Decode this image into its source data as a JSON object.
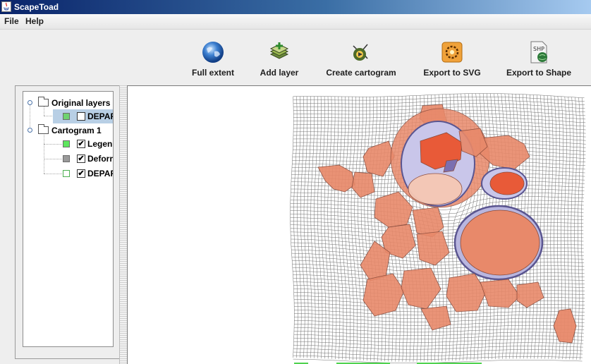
{
  "window": {
    "title": "ScapeToad",
    "icon": "java-icon"
  },
  "menu": {
    "items": [
      "File",
      "Help"
    ]
  },
  "toolbar": {
    "buttons": [
      {
        "label": "Full extent",
        "icon": "globe-icon"
      },
      {
        "label": "Add layer",
        "icon": "add-layer-icon"
      },
      {
        "label": "Create cartogram",
        "icon": "create-cartogram-icon"
      },
      {
        "label": "Export to SVG",
        "icon": "export-svg-icon"
      },
      {
        "label": "Export to Shape",
        "icon": "export-shape-icon"
      }
    ]
  },
  "layers": {
    "groups": [
      {
        "label": "Original layers",
        "items": [
          {
            "label": "DEPAR",
            "checked": false,
            "swatch_color": "#6fd36f",
            "selected": true
          }
        ]
      },
      {
        "label": "Cartogram 1",
        "items": [
          {
            "label": "Legen",
            "checked": true,
            "swatch_color": "#5ee65e",
            "selected": false
          },
          {
            "label": "Deforr",
            "checked": true,
            "swatch_color": "#9a9a9a",
            "selected": false
          },
          {
            "label": "DEPAR",
            "checked": true,
            "swatch_color": "#ffffff",
            "selected": false
          }
        ]
      }
    ]
  },
  "colors": {
    "titlebar_start": "#0a246a",
    "selection": "#b8cfe5",
    "region_fill": "#e8896a",
    "region_fill_dark": "#e85a38",
    "region_edge": "#8a4a3a",
    "lake_fill": "#c9c6ea",
    "lake_edge": "#5a5590",
    "grid_line": "#707070"
  }
}
